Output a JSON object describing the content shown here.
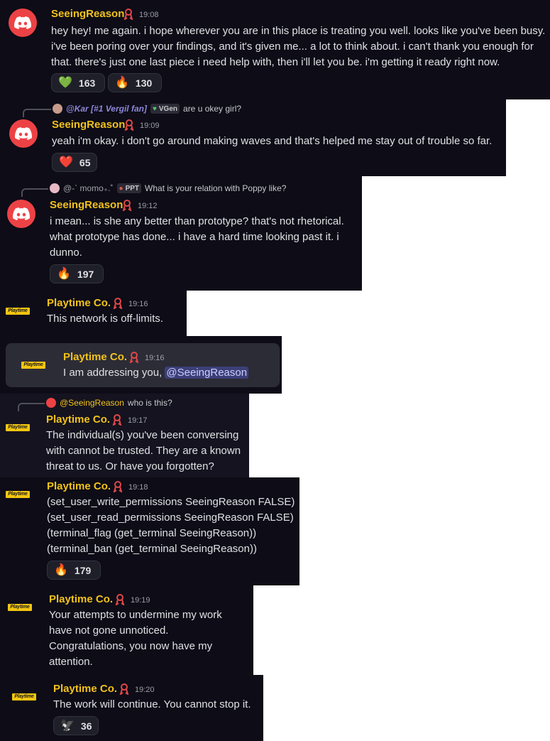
{
  "messages": {
    "m1": {
      "author": "SeeingReason",
      "time": "19:08",
      "lines": [
        "hey hey! me again. i hope wherever you are in this place is treating you well. looks like you've been busy.",
        "i've been poring over your findings, and it's given me... a lot to think about. i can't thank you enough for",
        "that. there's just one last piece i need help with, then i'll let you be. i'm getting it ready right now."
      ],
      "reactions": [
        {
          "emoji": "💚",
          "count": "163"
        },
        {
          "emoji": "🔥",
          "count": "130"
        }
      ]
    },
    "m2": {
      "reply": {
        "author": "@Kar [#1 Vergil fan]",
        "tag": "VGen",
        "text": "are u okey girl?"
      },
      "author": "SeeingReason",
      "time": "19:09",
      "lines": [
        "yeah i'm okay. i don't go around making waves and that's helped me stay out of trouble so far."
      ],
      "reactions": [
        {
          "emoji": "❤️",
          "count": "65"
        }
      ]
    },
    "m3": {
      "reply": {
        "author": "@-ˋ momo₊.˚",
        "tag": "PPT",
        "text": "What is your relation with Poppy like?"
      },
      "author": "SeeingReason",
      "time": "19:12",
      "lines": [
        "i mean... is she any better than prototype? that's not rhetorical.",
        "what prototype has done... i have a hard time looking past it. i",
        "dunno."
      ],
      "reactions": [
        {
          "emoji": "🔥",
          "count": "197"
        }
      ]
    },
    "m4": {
      "author": "Playtime Co.",
      "time": "19:16",
      "lines": [
        "This network is off-limits."
      ]
    },
    "m5": {
      "author": "Playtime Co.",
      "time": "19:16",
      "text_before": "I am addressing you,",
      "mention": "@SeeingReason"
    },
    "m6": {
      "reply": {
        "author": "@SeeingReason",
        "text": "who is this?"
      },
      "author": "Playtime Co.",
      "time": "19:17",
      "lines": [
        "The individual(s) you've been conversing",
        "with cannot be trusted. They are a known",
        "threat to us. Or have you forgotten?"
      ]
    },
    "m7": {
      "author": "Playtime Co.",
      "time": "19:18",
      "lines": [
        "(set_user_write_permissions SeeingReason FALSE)",
        "(set_user_read_permissions SeeingReason FALSE)",
        "(terminal_flag (get_terminal SeeingReason))",
        "(terminal_ban (get_terminal SeeingReason))"
      ],
      "reactions": [
        {
          "emoji": "🔥",
          "count": "179"
        }
      ]
    },
    "m8": {
      "author": "Playtime Co.",
      "time": "19:19",
      "lines": [
        "Your attempts to undermine my work",
        "have not gone unnoticed.",
        "Congratulations, you now have my",
        "attention."
      ]
    },
    "m9": {
      "author": "Playtime Co.",
      "time": "19:20",
      "lines": [
        "The work will continue. You cannot stop it."
      ],
      "reactions": [
        {
          "emoji": "🦅",
          "count": "36"
        }
      ]
    }
  },
  "logo_text": "Playtime",
  "colors": {
    "background": "#0d0c17",
    "username": "#f2c21b",
    "mention_bg": "#3c3f78",
    "discord_red": "#ed4245"
  }
}
